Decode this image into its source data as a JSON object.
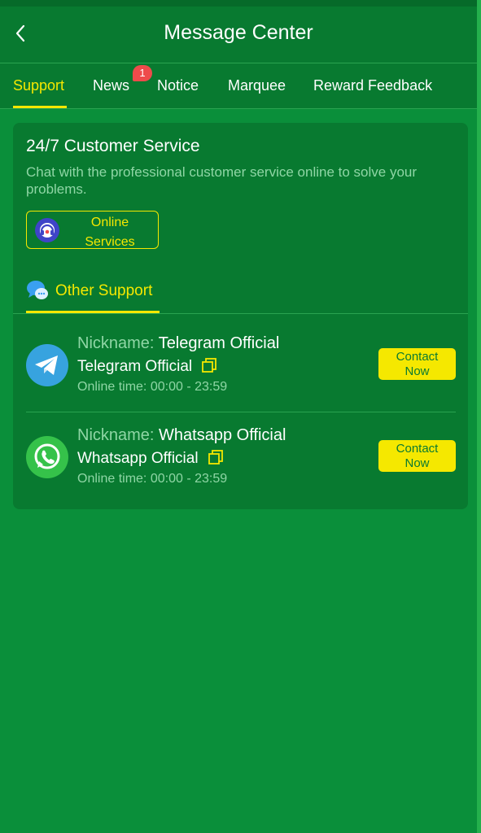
{
  "header": {
    "title": "Message Center",
    "back_icon": "chevron-left-icon"
  },
  "tabs": [
    {
      "label": "Support",
      "active": true
    },
    {
      "label": "News",
      "badge": "1"
    },
    {
      "label": "Notice"
    },
    {
      "label": "Marquee"
    },
    {
      "label": "Reward Feedback"
    }
  ],
  "customer_service": {
    "title": "24/7 Customer Service",
    "description": "Chat with the professional customer service online to solve your problems.",
    "online_button": {
      "line1": "Online",
      "line2": "Services",
      "icon": "headset-icon"
    }
  },
  "other_support": {
    "label": "Other Support",
    "icon": "chat-bubbles-icon"
  },
  "contacts": [
    {
      "nickname_label": "Nickname:",
      "nickname": "Telegram Official",
      "name": "Telegram Official",
      "time_label": "Online time:",
      "time": "00:00 - 23:59",
      "button_line1": "Contact",
      "button_line2": "Now",
      "icon": "telegram-icon"
    },
    {
      "nickname_label": "Nickname:",
      "nickname": "Whatsapp Official",
      "name": "Whatsapp Official",
      "time_label": "Online time:",
      "time": "00:00 - 23:59",
      "button_line1": "Contact",
      "button_line2": "Now",
      "icon": "whatsapp-icon"
    }
  ],
  "colors": {
    "background": "#0a8f3a",
    "panel": "#087a30",
    "accent": "#f5e800",
    "muted_text": "#8fd6a5",
    "badge": "#ee4b4b"
  }
}
